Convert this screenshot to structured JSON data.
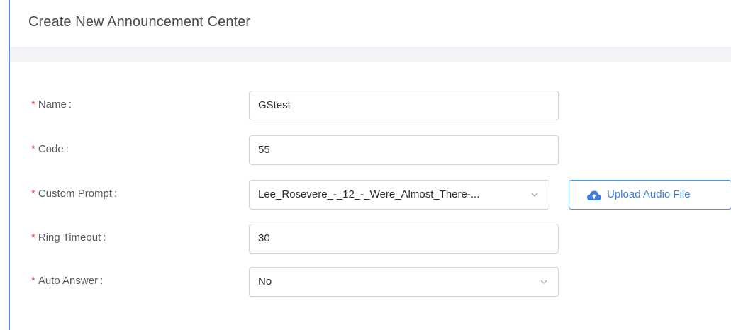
{
  "header": {
    "title": "Create New Announcement Center"
  },
  "form": {
    "required_marker": "*",
    "name": {
      "label": "Name\t:",
      "label_text": "Name",
      "value": "GStest"
    },
    "code": {
      "label_text": "Code",
      "value": "55"
    },
    "custom_prompt": {
      "label_text": "Custom Prompt",
      "value": "Lee_Rosevere_-_12_-_Were_Almost_There-...",
      "upload_button_label": "Upload Audio File",
      "upload_icon": "cloud-upload-icon"
    },
    "ring_timeout": {
      "label_text": "Ring Timeout",
      "value": "30"
    },
    "auto_answer": {
      "label_text": "Auto Answer",
      "value": "No"
    },
    "label_suffix": ":"
  },
  "colors": {
    "accent": "#3f7fd9",
    "required": "#e5484d",
    "frame_border": "#5b8fd9"
  }
}
